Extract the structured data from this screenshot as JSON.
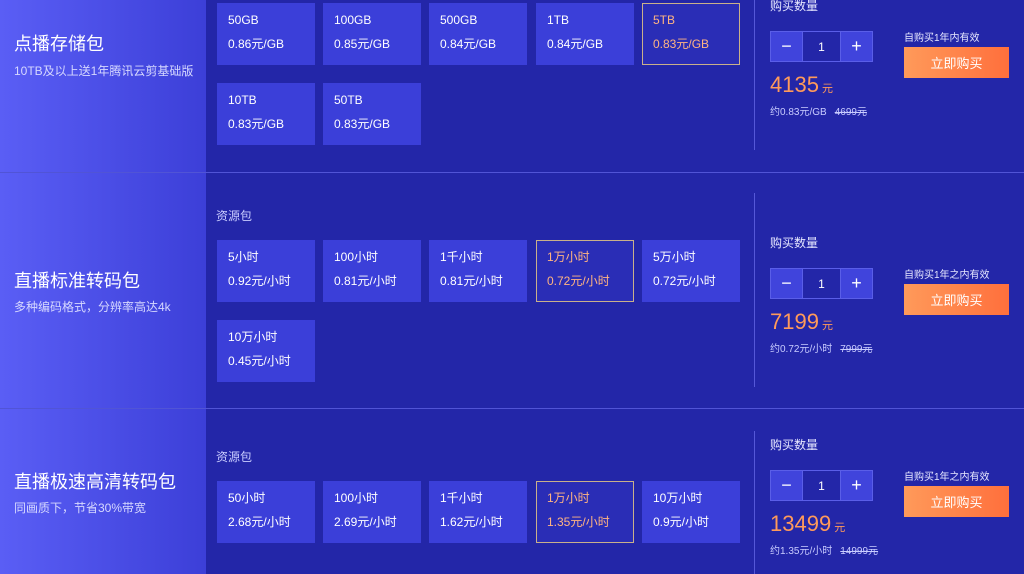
{
  "products": [
    {
      "title": "点播存储包",
      "subtitle": "10TB及以上送1年腾讯云剪基础版",
      "resource_label": "",
      "tiles": [
        {
          "name": "50GB",
          "price": "0.86元/GB",
          "selected": false
        },
        {
          "name": "100GB",
          "price": "0.85元/GB",
          "selected": false
        },
        {
          "name": "500GB",
          "price": "0.84元/GB",
          "selected": false
        },
        {
          "name": "1TB",
          "price": "0.84元/GB",
          "selected": false
        },
        {
          "name": "5TB",
          "price": "0.83元/GB",
          "selected": true
        },
        {
          "name": "10TB",
          "price": "0.83元/GB",
          "selected": false
        },
        {
          "name": "50TB",
          "price": "0.83元/GB",
          "selected": false
        }
      ],
      "qty_label": "购买数量",
      "minus": "−",
      "plus": "+",
      "quantity": "1",
      "price": "4135",
      "currency": "元",
      "approx": "约0.83元/GB",
      "original": "4699元",
      "validity": "自购买1年内有效",
      "buy_label": "立即购买"
    },
    {
      "title": "直播标准转码包",
      "subtitle": "多种编码格式，分辨率高达4k",
      "resource_label": "资源包",
      "tiles": [
        {
          "name": "5小时",
          "price": "0.92元/小时",
          "selected": false
        },
        {
          "name": "100小时",
          "price": "0.81元/小时",
          "selected": false
        },
        {
          "name": "1千小时",
          "price": "0.81元/小时",
          "selected": false
        },
        {
          "name": "1万小时",
          "price": "0.72元/小时",
          "selected": true
        },
        {
          "name": "5万小时",
          "price": "0.72元/小时",
          "selected": false
        },
        {
          "name": "10万小时",
          "price": "0.45元/小时",
          "selected": false
        }
      ],
      "qty_label": "购买数量",
      "minus": "−",
      "plus": "+",
      "quantity": "1",
      "price": "7199",
      "currency": "元",
      "approx": "约0.72元/小时",
      "original": "7999元",
      "validity": "自购买1年之内有效",
      "buy_label": "立即购买"
    },
    {
      "title": "直播极速高清转码包",
      "subtitle": "同画质下，节省30%带宽",
      "resource_label": "资源包",
      "tiles": [
        {
          "name": "50小时",
          "price": "2.68元/小时",
          "selected": false
        },
        {
          "name": "100小时",
          "price": "2.69元/小时",
          "selected": false
        },
        {
          "name": "1千小时",
          "price": "1.62元/小时",
          "selected": false
        },
        {
          "name": "1万小时",
          "price": "1.35元/小时",
          "selected": true
        },
        {
          "name": "10万小时",
          "price": "0.9元/小时",
          "selected": false
        }
      ],
      "qty_label": "购买数量",
      "minus": "−",
      "plus": "+",
      "quantity": "1",
      "price": "13499",
      "currency": "元",
      "approx": "约1.35元/小时",
      "original": "14999元",
      "validity": "自购买1年之内有效",
      "buy_label": "立即购买"
    }
  ]
}
